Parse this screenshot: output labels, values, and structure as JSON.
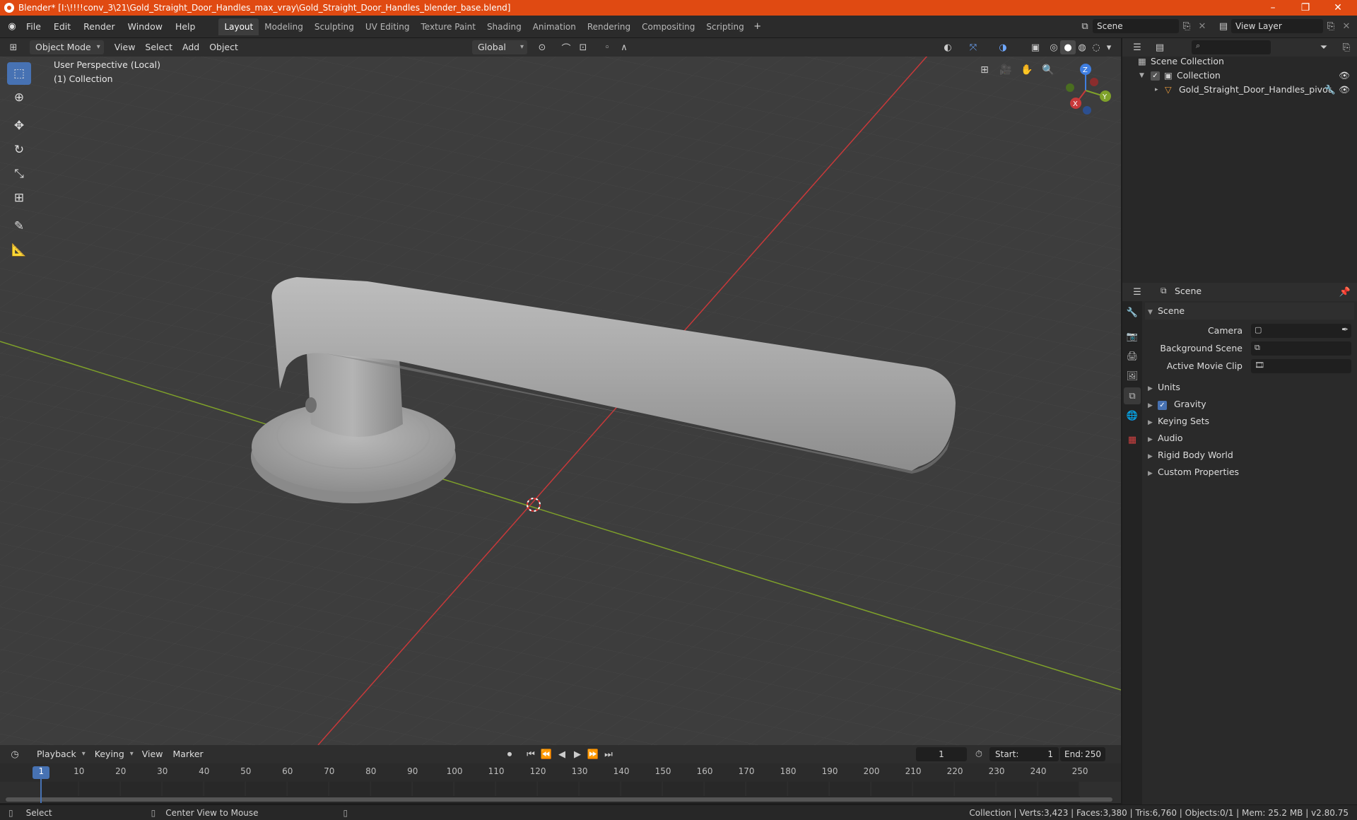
{
  "window": {
    "title": "Blender* [I:\\!!!!conv_3\\21\\Gold_Straight_Door_Handles_max_vray\\Gold_Straight_Door_Handles_blender_base.blend]",
    "minimize": "–",
    "restore": "❐",
    "close": "✕"
  },
  "menu": [
    "File",
    "Edit",
    "Render",
    "Window",
    "Help"
  ],
  "workspaces": [
    "Layout",
    "Modeling",
    "Sculpting",
    "UV Editing",
    "Texture Paint",
    "Shading",
    "Animation",
    "Rendering",
    "Compositing",
    "Scripting"
  ],
  "active_workspace": "Layout",
  "scene_field": "Scene",
  "view_layer_field": "View Layer",
  "viewport": {
    "mode": "Object Mode",
    "menus": [
      "View",
      "Select",
      "Add",
      "Object"
    ],
    "transform_orientation": "Global",
    "perspective_label": "User Perspective (Local)",
    "collection_label": "(1) Collection",
    "gizmo": {
      "x": "X",
      "y": "Y",
      "z": "Z"
    }
  },
  "outliner": {
    "search_placeholder": "",
    "items": [
      {
        "label": "Scene Collection"
      },
      {
        "label": "Collection"
      },
      {
        "label": "Gold_Straight_Door_Handles_pivot"
      }
    ]
  },
  "properties": {
    "context": "Scene",
    "panel_title": "Scene",
    "fields": [
      {
        "label": "Camera"
      },
      {
        "label": "Background Scene"
      },
      {
        "label": "Active Movie Clip"
      }
    ],
    "subpanels": [
      "Units",
      "Gravity",
      "Keying Sets",
      "Audio",
      "Rigid Body World",
      "Custom Properties"
    ]
  },
  "timeline": {
    "menus": [
      "Playback",
      "Keying",
      "View",
      "Marker"
    ],
    "current_frame": "1",
    "start_label": "Start:",
    "start_value": "1",
    "end_label": "End:",
    "end_value": "250",
    "ticks": [
      "1",
      "10",
      "20",
      "30",
      "40",
      "50",
      "60",
      "70",
      "80",
      "90",
      "100",
      "110",
      "120",
      "130",
      "140",
      "150",
      "160",
      "170",
      "180",
      "190",
      "200",
      "210",
      "220",
      "230",
      "240",
      "250"
    ]
  },
  "status": {
    "left": "Select",
    "middle": "Center View to Mouse",
    "right": "Collection | Verts:3,423 | Faces:3,380 | Tris:6,760 | Objects:0/1 | Mem: 25.2 MB | v2.80.75"
  },
  "colors": {
    "title_bar": "#e04a12",
    "accent": "#4772b3",
    "axis_x": "#c8393a",
    "axis_y": "#7fa12a",
    "axis_z": "#3f7ee0"
  }
}
